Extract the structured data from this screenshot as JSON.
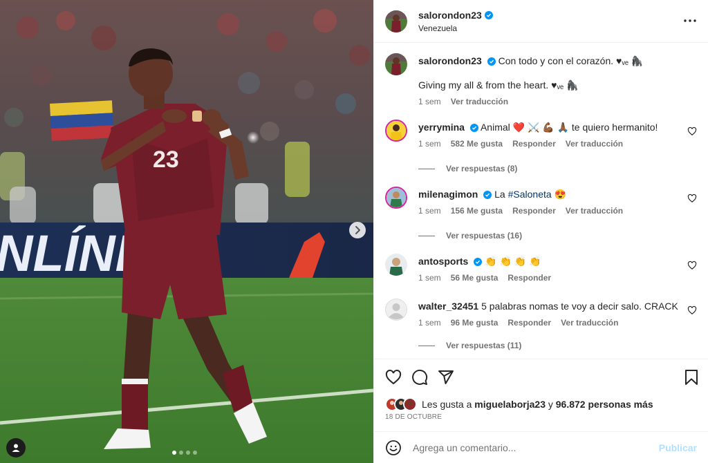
{
  "post": {
    "author": "salorondon23",
    "location": "Venezuela",
    "date": "18 DE OCTUBRE",
    "photo_index": 1,
    "photo_count": 4
  },
  "caption": {
    "username": "salorondon23",
    "text": "Con todo y con el corazón. ♥ᵥₑ 🦍",
    "text2": "Giving my all & from the heart. ♥ᵥₑ 🦍",
    "time": "1 sem",
    "translate": "Ver traducción"
  },
  "comments": [
    {
      "username": "yerrymina",
      "text": "Animal ❤️ ⚔️ 💪🏾 🙏🏾 te quiero hermanito!",
      "time": "1 sem",
      "likes": "582 Me gusta",
      "reply": "Responder",
      "translate": "Ver traducción",
      "replies": "Ver respuestas (8)"
    },
    {
      "username": "milenagimon",
      "text_pre": "La ",
      "hashtag": "#Saloneta",
      "text_post": " 😍",
      "time": "1 sem",
      "likes": "156 Me gusta",
      "reply": "Responder",
      "translate": "Ver traducción",
      "replies": "Ver respuestas (16)"
    },
    {
      "username": "antosports",
      "text": "👏 👏 👏 👏",
      "time": "1 sem",
      "likes": "56 Me gusta",
      "reply": "Responder"
    },
    {
      "username": "walter_32451",
      "text": "5 palabras nomas te voy a decir salo. CRACK",
      "time": "1 sem",
      "likes": "96 Me gusta",
      "reply": "Responder",
      "translate": "Ver traducción",
      "replies": "Ver respuestas (11)"
    }
  ],
  "likes": {
    "prefix": "Les gusta a ",
    "user": "miguelaborja23",
    "middle": " y ",
    "count": "96.872 personas más"
  },
  "add_comment": {
    "placeholder": "Agrega un comentario...",
    "publish": "Publicar"
  },
  "photo": {
    "jersey_number": "23",
    "banner_text": "NLÍNE"
  },
  "icons": {
    "like": "heart-icon",
    "comment": "comment-icon",
    "share": "share-icon",
    "save": "bookmark-icon",
    "emoji": "emoji-icon",
    "more": "more-icon",
    "next": "chevron-right-icon",
    "tags": "user-tag-icon"
  },
  "colors": {
    "verified": "#0095f6",
    "text_secondary": "#737373",
    "publish_disabled": "#b2dffc",
    "jersey": "#7a1f2b"
  }
}
